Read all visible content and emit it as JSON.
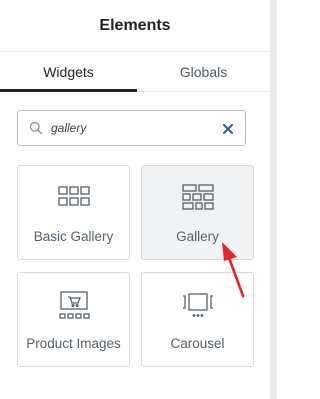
{
  "panel": {
    "title": "Elements"
  },
  "tabs": [
    {
      "label": "Widgets",
      "active": true
    },
    {
      "label": "Globals",
      "active": false
    }
  ],
  "search": {
    "value": "gallery",
    "icon": "search-icon",
    "clear_icon": "close-icon"
  },
  "widgets": [
    {
      "label": "Basic Gallery",
      "icon": "basic-gallery-icon"
    },
    {
      "label": "Gallery",
      "icon": "gallery-icon",
      "hovered": true
    },
    {
      "label": "Product Images",
      "icon": "product-images-icon"
    },
    {
      "label": "Carousel",
      "icon": "carousel-icon"
    }
  ],
  "annotation": {
    "type": "arrow",
    "color": "#e8262a"
  },
  "colors": {
    "accent_border": "#1f2124",
    "annotation_red": "#e8262a",
    "icon_gray": "#556068"
  }
}
